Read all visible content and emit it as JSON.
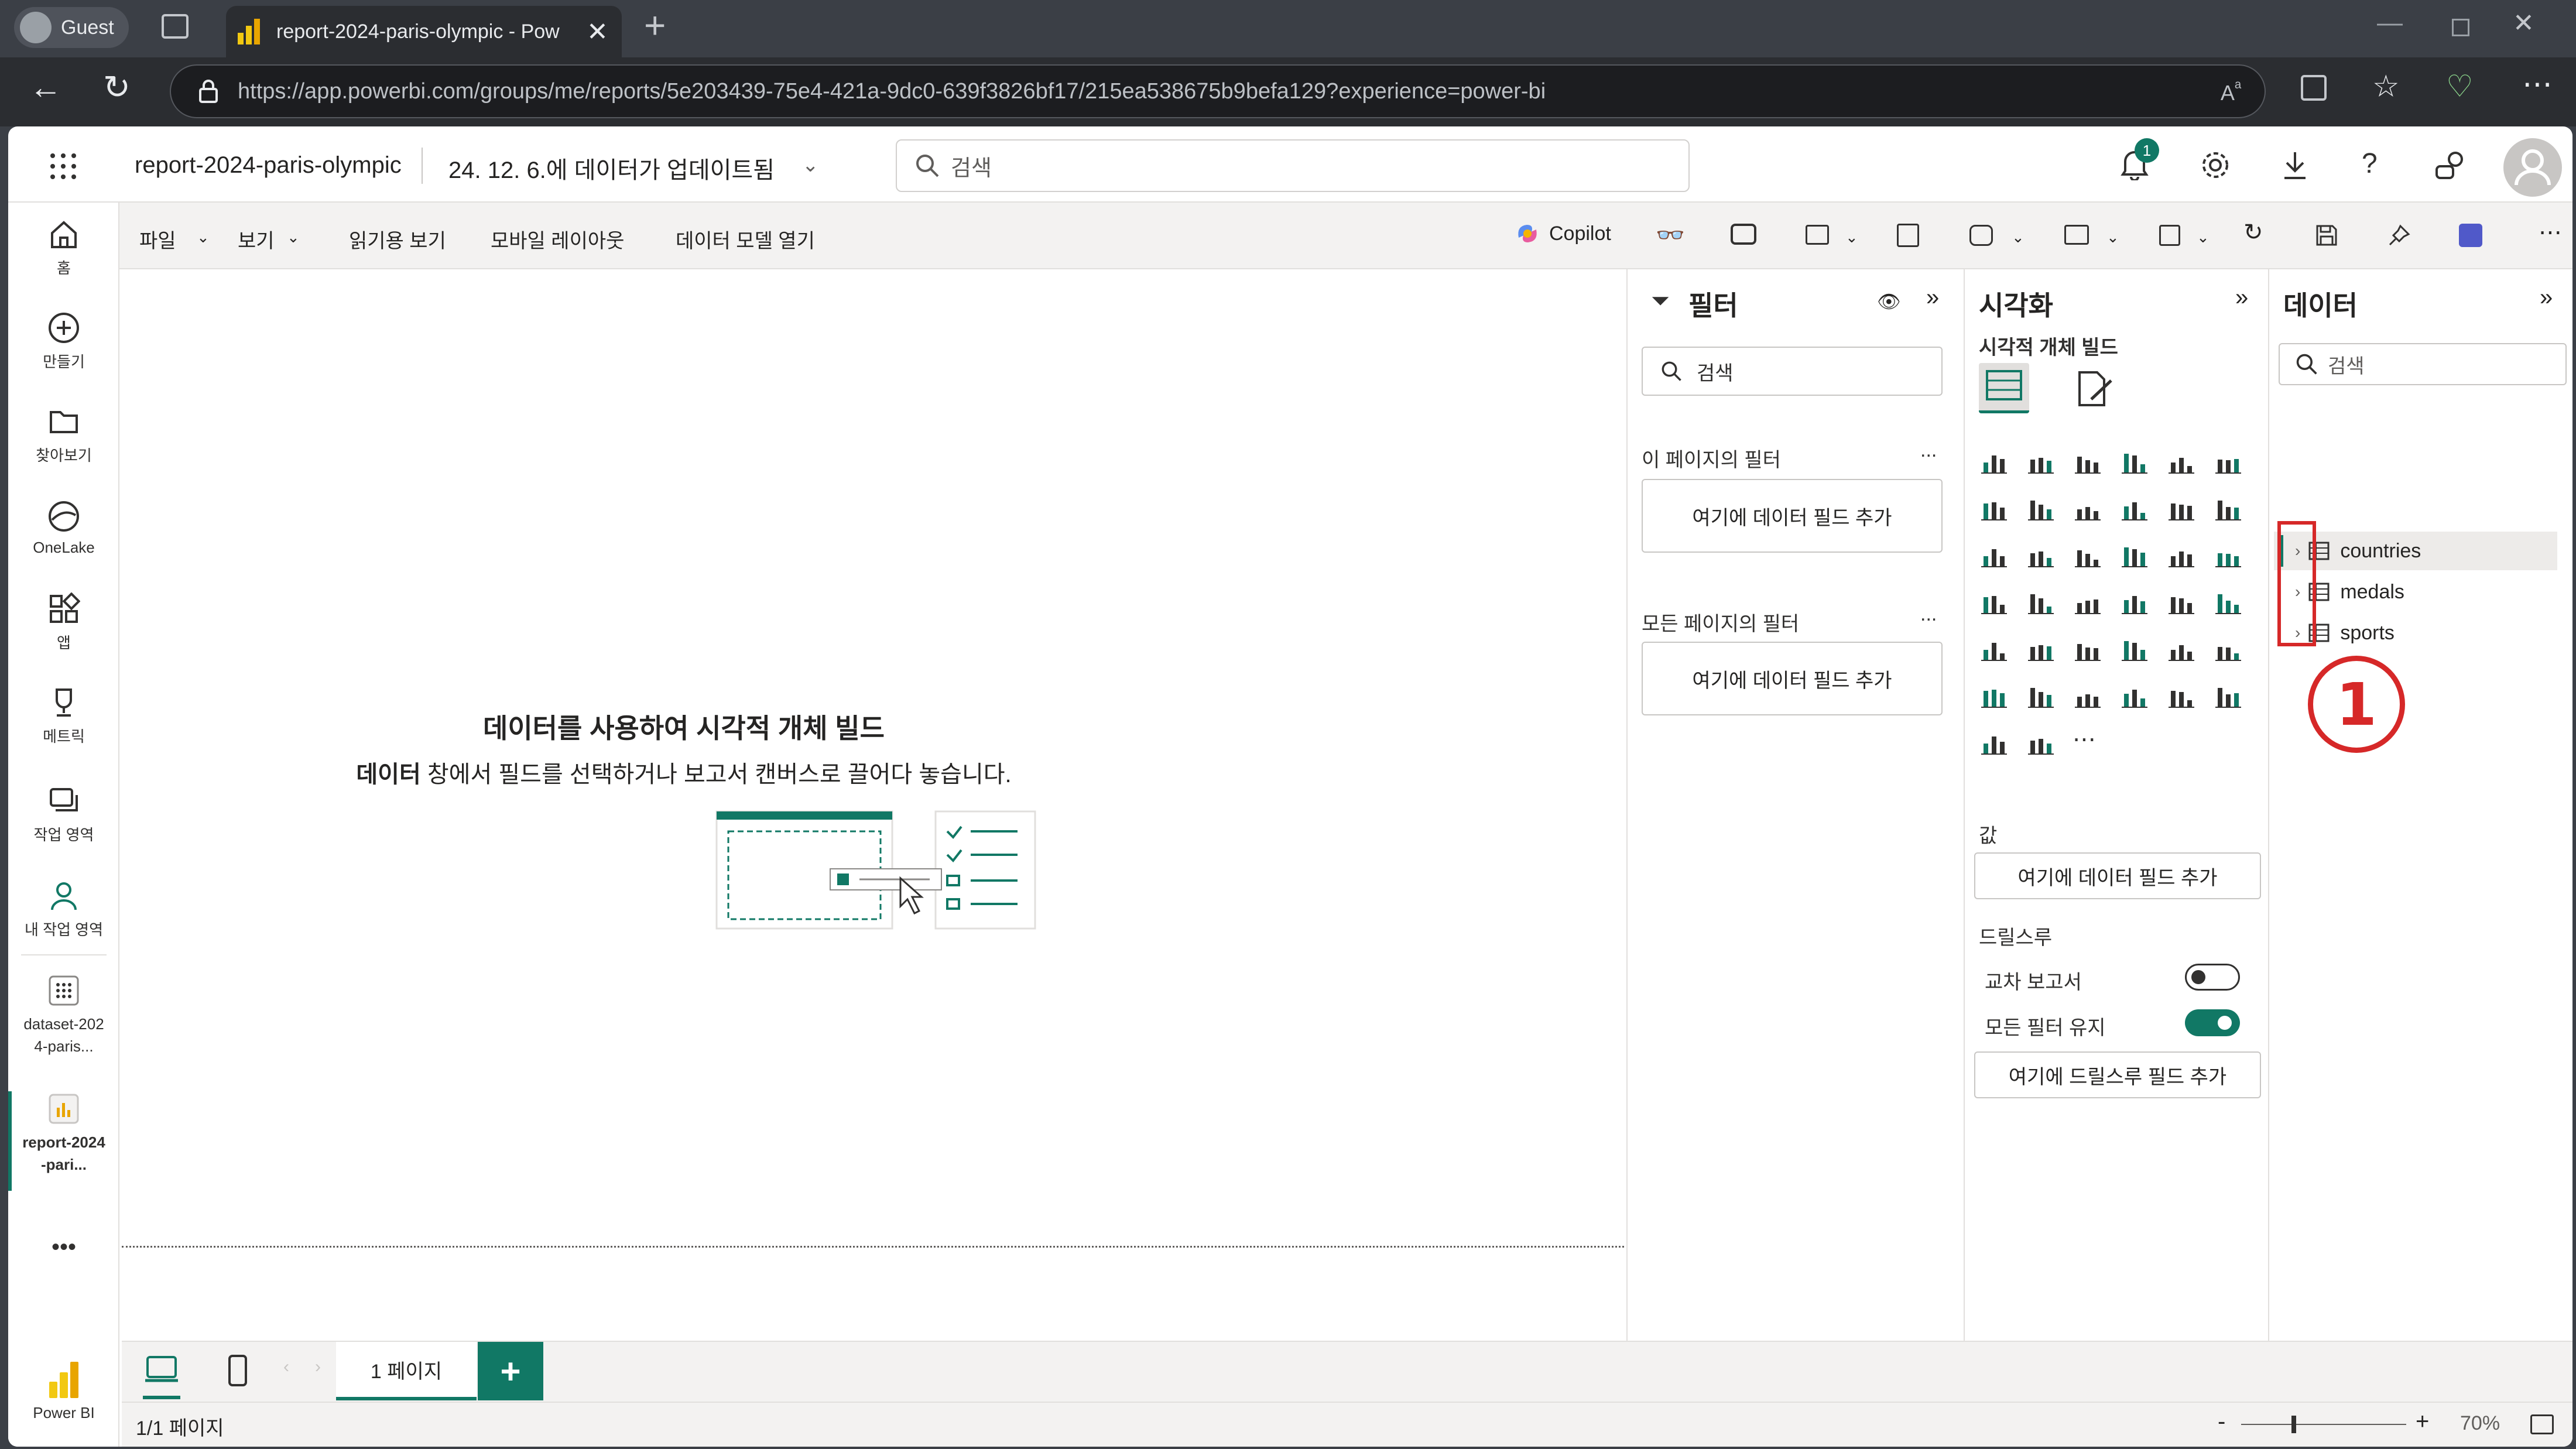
{
  "browser": {
    "profile": "Guest",
    "tab_title": "report-2024-paris-olympic - Pow",
    "url": "https://app.powerbi.com/groups/me/reports/5e203439-75e4-421a-9dc0-639f3826bf17/215ea538675b9befa129?experience=power-bi"
  },
  "header": {
    "report_name": "report-2024-paris-olympic",
    "updated": "24. 12. 6.에 데이터가 업데이트됨",
    "search_placeholder": "검색",
    "notification_count": "1"
  },
  "leftnav": [
    {
      "label": "홈",
      "icon": "home-icon"
    },
    {
      "label": "만들기",
      "icon": "plus-circle-icon"
    },
    {
      "label": "찾아보기",
      "icon": "folder-icon"
    },
    {
      "label": "OneLake",
      "icon": "onelake-icon"
    },
    {
      "label": "앱",
      "icon": "apps-icon"
    },
    {
      "label": "메트릭",
      "icon": "trophy-icon"
    },
    {
      "label": "작업 영역",
      "icon": "workspaces-icon"
    },
    {
      "label": "내 작업 영역",
      "icon": "person-icon"
    },
    {
      "label": "dataset-2024-paris...",
      "icon": "dataset-icon"
    },
    {
      "label": "report-2024-pari...",
      "icon": "report-icon"
    },
    {
      "label": "Power BI",
      "icon": "powerbi-logo-icon"
    }
  ],
  "ribbon": {
    "file": "파일",
    "view": "보기",
    "reading_view": "읽기용 보기",
    "mobile_layout": "모바일 레이아웃",
    "open_data_model": "데이터 모델 열기",
    "copilot": "Copilot"
  },
  "canvas": {
    "heading": "데이터를 사용하여 시각적 개체 빌드",
    "sub_bold": "데이터",
    "sub_rest": " 창에서 필드를 선택하거나 보고서 캔버스로 끌어다 놓습니다."
  },
  "filters": {
    "title": "필터",
    "search_placeholder": "검색",
    "this_page": "이 페이지의 필터",
    "all_pages": "모든 페이지의 필터",
    "add_field": "여기에 데이터 필드 추가",
    "more": "..."
  },
  "visualizations": {
    "title": "시각화",
    "build_label": "시각적 개체 빌드",
    "values_label": "값",
    "add_field": "여기에 데이터 필드 추가",
    "drillthrough": "드릴스루",
    "cross_report": "교차 보고서",
    "cross_report_on": false,
    "keep_filters": "모든 필터 유지",
    "keep_filters_on": true,
    "add_drill_field": "여기에 드릴스루 필드 추가",
    "more": "..."
  },
  "data_pane": {
    "title": "데이터",
    "search_placeholder": "검색",
    "tables": [
      "countries",
      "medals",
      "sports"
    ],
    "callout": "①"
  },
  "pages": {
    "tab": "1 페이지",
    "status": "1/1 페이지",
    "zoom": "70%"
  },
  "colors": {
    "accent": "#117865",
    "callout": "#d62828",
    "brand_yellow": "#f2c811"
  }
}
